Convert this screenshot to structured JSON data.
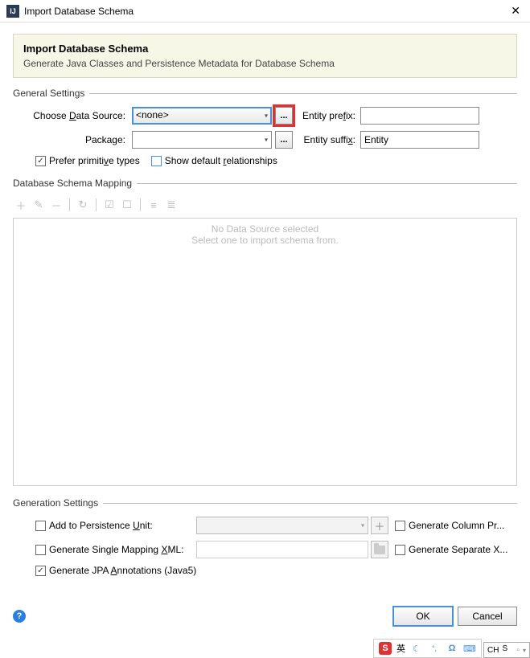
{
  "window": {
    "title": "Import Database Schema"
  },
  "header": {
    "title": "Import Database Schema",
    "subtitle": "Generate Java Classes and Persistence Metadata for Database Schema"
  },
  "general": {
    "section": "General Settings",
    "dataSourceLabel": "Choose Data Source:",
    "dataSourceValue": "<none>",
    "packageLabel": "Package:",
    "packageValue": "",
    "entityPrefixLabel": "Entity prefix:",
    "entityPrefixValue": "",
    "entitySuffixLabel": "Entity suffix:",
    "entitySuffixValue": "Entity",
    "preferPrimitive": "Prefer primitive types",
    "showDefaultRel": "Show default relationships",
    "browse": "..."
  },
  "mapping": {
    "section": "Database Schema Mapping",
    "empty1": "No Data Source selected",
    "empty2": "Select one to import schema from."
  },
  "generation": {
    "section": "Generation Settings",
    "addToUnit": "Add to Persistence Unit:",
    "genColumnPr": "Generate Column Pr...",
    "genSingleXml": "Generate Single Mapping XML:",
    "genSeparateX": "Generate Separate X...",
    "genJpa": "Generate JPA Annotations (Java5)"
  },
  "footer": {
    "ok": "OK",
    "cancel": "Cancel"
  },
  "ime": {
    "lang": "英",
    "ch": "CH"
  }
}
